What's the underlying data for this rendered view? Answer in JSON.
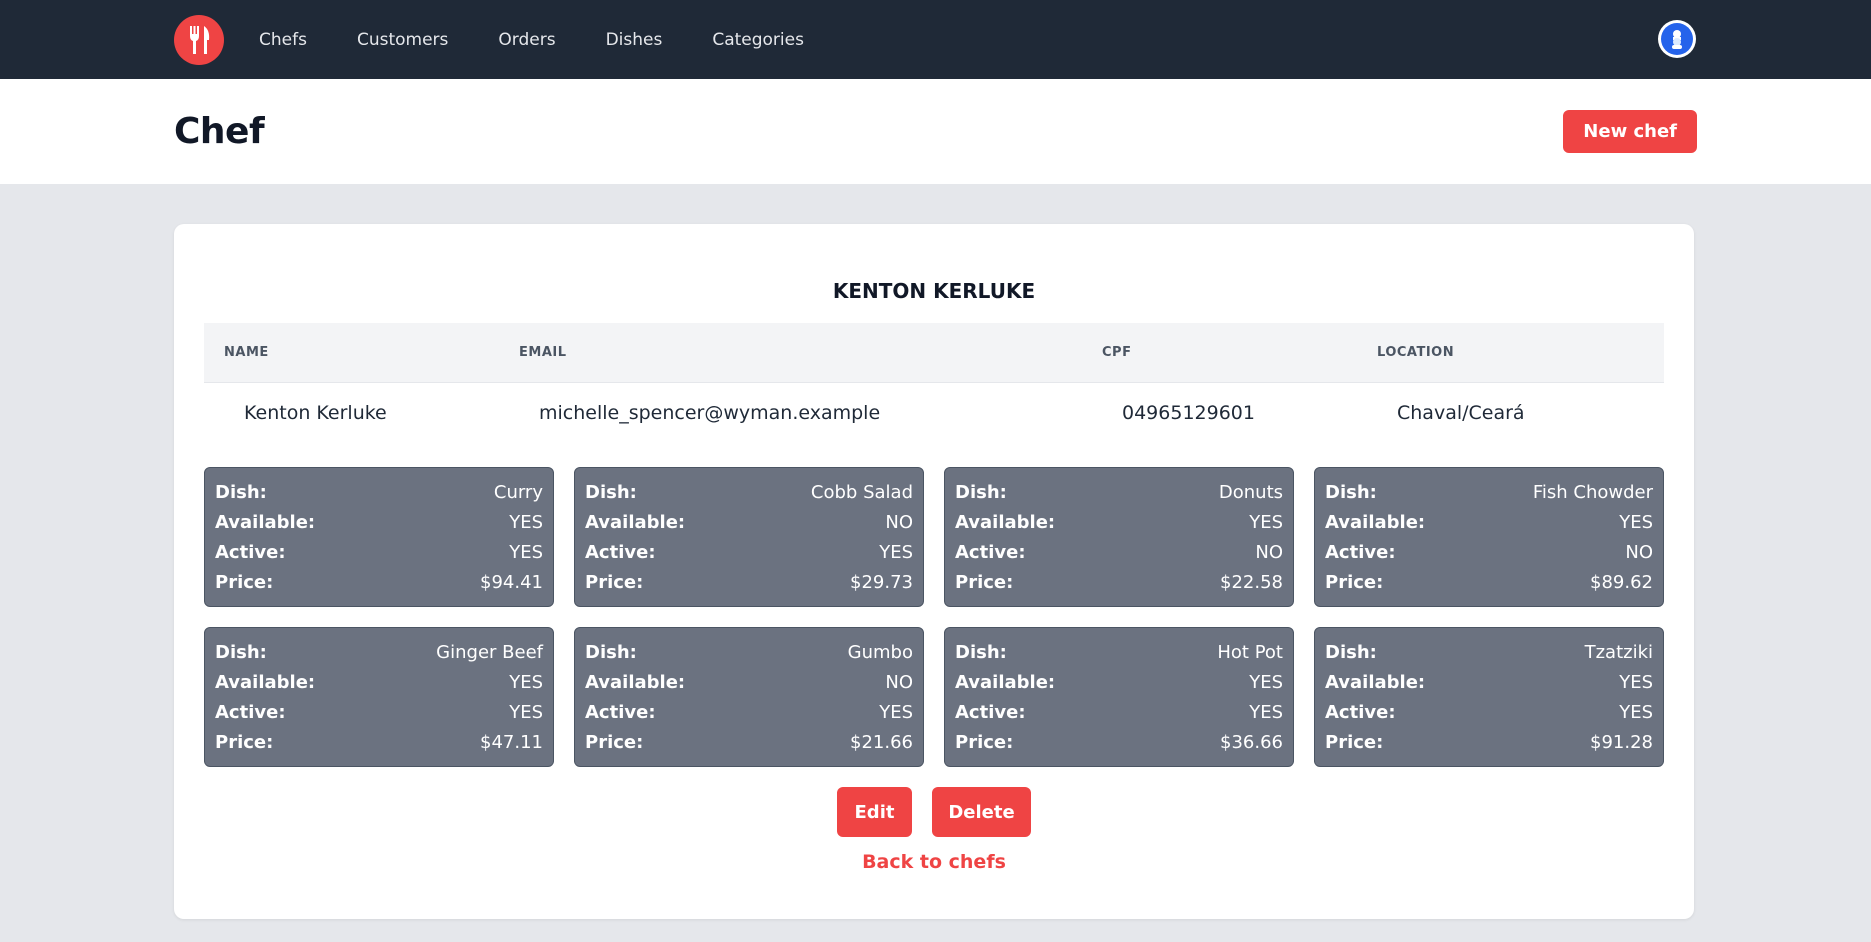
{
  "nav": {
    "links": [
      "Chefs",
      "Customers",
      "Orders",
      "Dishes",
      "Categories"
    ]
  },
  "header": {
    "title": "Chef",
    "new_button": "New chef"
  },
  "chef": {
    "heading": "KENTON KERLUKE",
    "columns": [
      "NAME",
      "EMAIL",
      "CPF",
      "LOCATION"
    ],
    "row": [
      "Kenton Kerluke",
      "michelle_spencer@wyman.example",
      "04965129601",
      "Chaval/Ceará"
    ]
  },
  "dish_labels": {
    "dish": "Dish:",
    "available": "Available:",
    "active": "Active:",
    "price": "Price:"
  },
  "dishes": [
    {
      "name": "Curry",
      "available": "YES",
      "active": "YES",
      "price": "$94.41"
    },
    {
      "name": "Cobb Salad",
      "available": "NO",
      "active": "YES",
      "price": "$29.73"
    },
    {
      "name": "Donuts",
      "available": "YES",
      "active": "NO",
      "price": "$22.58"
    },
    {
      "name": "Fish Chowder",
      "available": "YES",
      "active": "NO",
      "price": "$89.62"
    },
    {
      "name": "Ginger Beef",
      "available": "YES",
      "active": "YES",
      "price": "$47.11"
    },
    {
      "name": "Gumbo",
      "available": "NO",
      "active": "YES",
      "price": "$21.66"
    },
    {
      "name": "Hot Pot",
      "available": "YES",
      "active": "YES",
      "price": "$36.66"
    },
    {
      "name": "Tzatziki",
      "available": "YES",
      "active": "YES",
      "price": "$91.28"
    }
  ],
  "actions": {
    "edit": "Edit",
    "delete": "Delete",
    "back": "Back to chefs"
  },
  "colors": {
    "accent": "#ef4444",
    "navbar": "#1f2937",
    "dish_card": "#6b7280"
  },
  "icons": {
    "logo": "fork-knife-icon",
    "avatar": "user-avatar-icon"
  }
}
